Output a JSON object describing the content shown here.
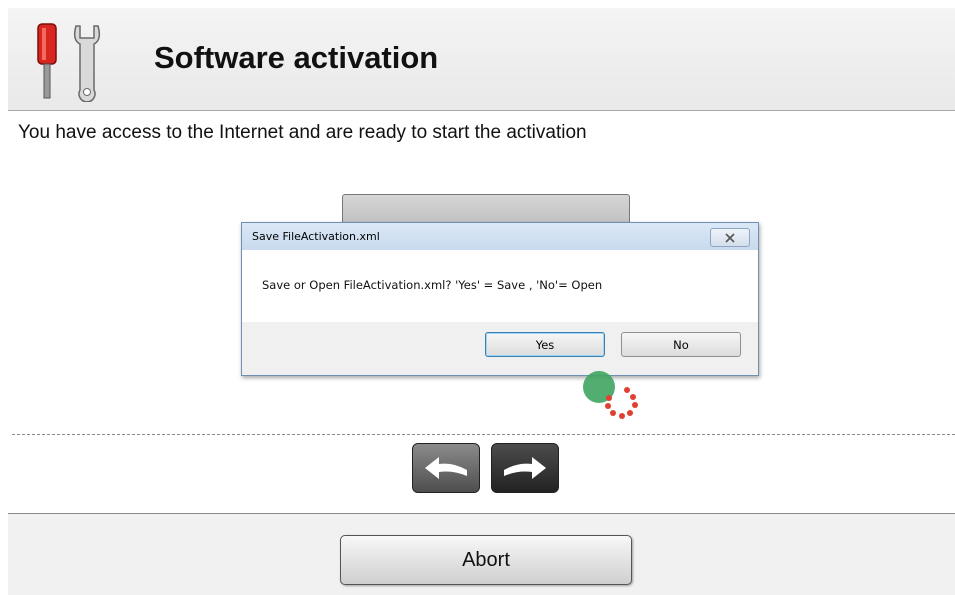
{
  "header": {
    "title": "Software activation",
    "icon": "screwdriver-wrench-icon"
  },
  "status_text": "You have access to the Internet and are ready to start the activation",
  "dialog": {
    "title": "Save FileActivation.xml",
    "message": "Save or Open FileActivation.xml? 'Yes' = Save , 'No'= Open",
    "yes_label": "Yes",
    "no_label": "No",
    "close_icon": "close-icon"
  },
  "nav": {
    "back_icon": "back-arrow-icon",
    "next_icon": "forward-arrow-icon"
  },
  "footer": {
    "abort_label": "Abort"
  },
  "colors": {
    "screwdriver_red": "#d8261f",
    "spinner_green": "#3fa561",
    "spinner_red": "#e04030",
    "dialog_border": "#6f8fb3"
  }
}
